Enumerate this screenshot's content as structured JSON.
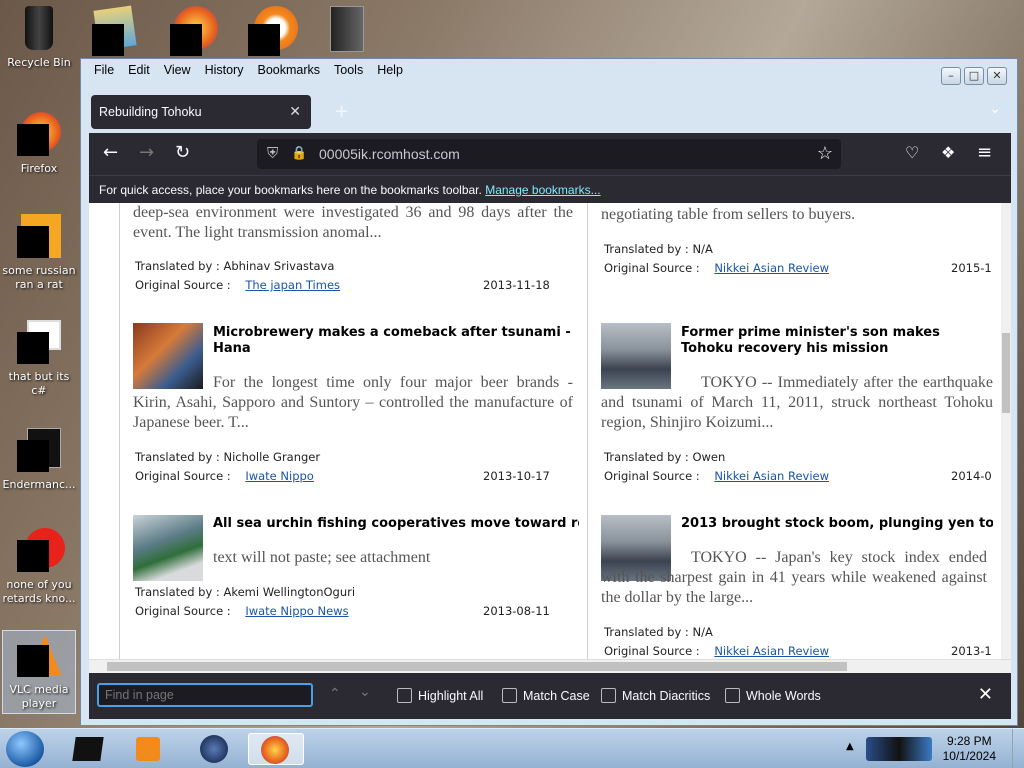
{
  "desktop": {
    "icons": [
      {
        "label": "Recycle Bin"
      },
      {
        "label": "Firefox"
      },
      {
        "label": "some russian ran a rat"
      },
      {
        "label": "that but its c#"
      },
      {
        "label": "Endermanc..."
      },
      {
        "label": "none of you retards kno..."
      },
      {
        "label": "VLC media player"
      }
    ]
  },
  "menubar": [
    "File",
    "Edit",
    "View",
    "History",
    "Bookmarks",
    "Tools",
    "Help"
  ],
  "tab": {
    "title": "Rebuilding Tohoku"
  },
  "urlbar": {
    "url": "00005ik.rcomhost.com"
  },
  "bookmarks_bar": {
    "text": "For quick access, place your bookmarks here on the bookmarks toolbar.",
    "link": "Manage bookmarks..."
  },
  "articles_left": [
    {
      "snippet": "deep-sea environment were investigated 36 and 98 days after the event. The light transmission anomal...",
      "translator_label": "Translated by :",
      "translator": "Abhinav Srivastava",
      "source_label": "Original Source :",
      "source": "The japan Times",
      "date": "2013-11-18"
    },
    {
      "title": "Microbrewery makes a comeback after tsunami - Hana",
      "snippet": "For the longest time only four major beer brands - Kirin, Asahi, Sapporo and Suntory – controlled the manufacture of Japanese beer.  T...",
      "translator_label": "Translated by :",
      "translator": "Nicholle Granger",
      "source_label": "Original Source :",
      "source": "Iwate Nippo",
      "date": "2013-10-17"
    },
    {
      "title": "All sea urchin fishing cooperatives move toward re",
      "snippet": "text will not paste; see attachment",
      "translator_label": "Translated by :",
      "translator": "Akemi WellingtonOguri",
      "source_label": "Original Source :",
      "source": "Iwate Nippo News",
      "date": "2013-08-11"
    }
  ],
  "articles_right": [
    {
      "snippet": "negotiating table from sellers to buyers.",
      "translator_label": "Translated by :",
      "translator": "N/A",
      "source_label": "Original Source :",
      "source": "Nikkei Asian Review",
      "date": "2015-1"
    },
    {
      "title": "Former prime minister's son makes Tohoku recovery his mission",
      "snippet": "TOKYO -- Immediately after the earthquake and tsunami of March 11, 2011, struck northeast Tohoku region, Shinjiro Koizumi...",
      "translator_label": "Translated by :",
      "translator": "Owen",
      "source_label": "Original Source :",
      "source": "Nikkei Asian Review",
      "date": "2014-0"
    },
    {
      "title": "2013 brought stock boom, plunging yen to",
      "snippet": "TOKYO -- Japan's key stock index ended with the sharpest gain in 41 years while weakened against the dollar by the large...",
      "translator_label": "Translated by :",
      "translator": "N/A",
      "source_label": "Original Source :",
      "source": "Nikkei Asian Review",
      "date": "2013-1"
    }
  ],
  "findbar": {
    "placeholder": "Find in page",
    "highlight_all": "Highlight All",
    "match_case": "Match Case",
    "match_diacritics": "Match Diacritics",
    "whole_words": "Whole Words"
  },
  "taskbar": {
    "time": "9:28 PM",
    "date": "10/1/2024"
  }
}
